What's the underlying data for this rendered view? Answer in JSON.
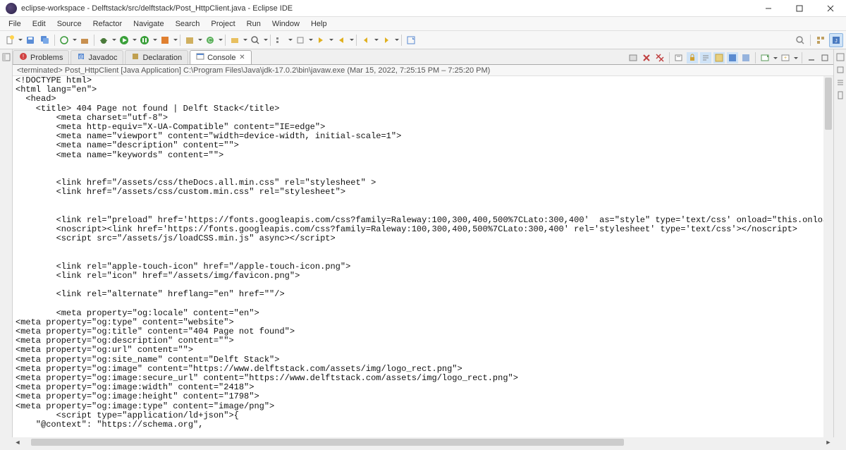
{
  "titlebar": {
    "text": "eclipse-workspace - Delftstack/src/delftstack/Post_HttpClient.java - Eclipse IDE"
  },
  "menu": {
    "items": [
      "File",
      "Edit",
      "Source",
      "Refactor",
      "Navigate",
      "Search",
      "Project",
      "Run",
      "Window",
      "Help"
    ]
  },
  "views": {
    "tabs": [
      {
        "label": "Problems",
        "icon": "problems-icon"
      },
      {
        "label": "Javadoc",
        "icon": "javadoc-icon"
      },
      {
        "label": "Declaration",
        "icon": "declaration-icon"
      },
      {
        "label": "Console",
        "icon": "console-icon",
        "active": true,
        "closable": true
      }
    ]
  },
  "console": {
    "status": "<terminated> Post_HttpClient [Java Application] C:\\Program Files\\Java\\jdk-17.0.2\\bin\\javaw.exe (Mar 15, 2022, 7:25:15 PM – 7:25:20 PM)",
    "lines": [
      "<!DOCTYPE html>",
      "<html lang=\"en\">",
      "  <head>",
      "    <title> 404 Page not found | Delft Stack</title>",
      "        <meta charset=\"utf-8\">",
      "        <meta http-equiv=\"X-UA-Compatible\" content=\"IE=edge\">",
      "        <meta name=\"viewport\" content=\"width=device-width, initial-scale=1\">",
      "        <meta name=\"description\" content=\"\">",
      "        <meta name=\"keywords\" content=\"\">",
      "",
      "",
      "        <link href=\"/assets/css/theDocs.all.min.css\" rel=\"stylesheet\" >",
      "        <link href=\"/assets/css/custom.min.css\" rel=\"stylesheet\">",
      "",
      "",
      "        <link rel=\"preload\" href='https://fonts.googleapis.com/css?family=Raleway:100,300,400,500%7CLato:300,400'  as=\"style\" type='text/css' onload=\"this.onload=null;this.rel='styleshee",
      "        <noscript><link href='https://fonts.googleapis.com/css?family=Raleway:100,300,400,500%7CLato:300,400' rel='stylesheet' type='text/css'></noscript>",
      "        <script src=\"/assets/js/loadCSS.min.js\" async></script>",
      "",
      "",
      "        <link rel=\"apple-touch-icon\" href=\"/apple-touch-icon.png\">",
      "        <link rel=\"icon\" href=\"/assets/img/favicon.png\">",
      "",
      "        <link rel=\"alternate\" hreflang=\"en\" href=\"\"/>",
      "",
      "        <meta property=\"og:locale\" content=\"en\">",
      "<meta property=\"og:type\" content=\"website\">",
      "<meta property=\"og:title\" content=\"404 Page not found\">",
      "<meta property=\"og:description\" content=\"\">",
      "<meta property=\"og:url\" content=\"\">",
      "<meta property=\"og:site_name\" content=\"Delft Stack\">",
      "<meta property=\"og:image\" content=\"https://www.delftstack.com/assets/img/logo_rect.png\">",
      "<meta property=\"og:image:secure_url\" content=\"https://www.delftstack.com/assets/img/logo_rect.png\">",
      "<meta property=\"og:image:width\" content=\"2418\">",
      "<meta property=\"og:image:height\" content=\"1798\">",
      "<meta property=\"og:image:type\" content=\"image/png\">",
      "        <script type=\"application/ld+json\">{",
      "    \"@context\": \"https://schema.org\","
    ]
  },
  "colors": {
    "titlebar_bg": "#ffffff",
    "menubar_bg": "#f7f7f7",
    "border": "#d0d0d0"
  }
}
